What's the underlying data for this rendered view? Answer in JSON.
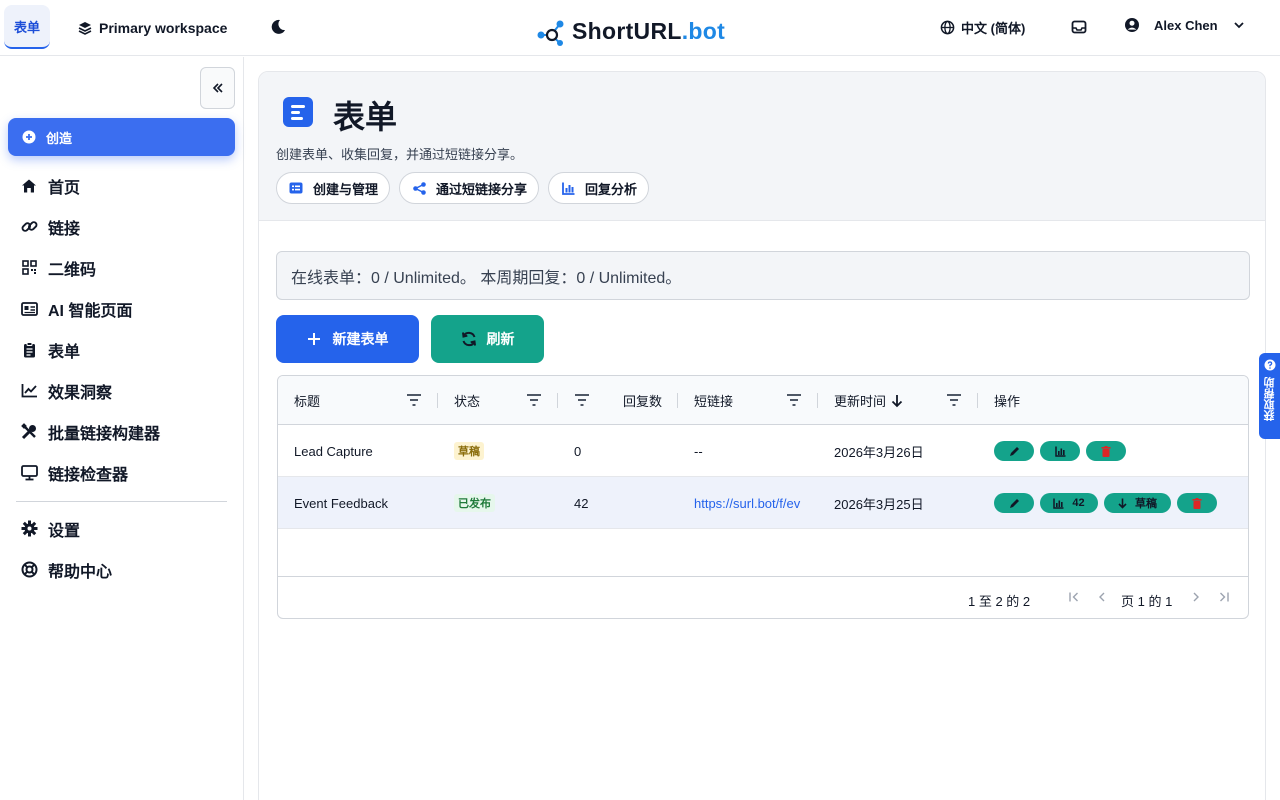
{
  "topbar": {
    "active_tab": "表单",
    "workspace": "Primary workspace",
    "brand_main": "ShortURL",
    "brand_dot": ".bot",
    "language": "中文 (简体)",
    "user_name": "Alex Chen"
  },
  "sidebar": {
    "create_label": "创造",
    "items": [
      {
        "label": "首页",
        "icon": "home-icon"
      },
      {
        "label": "链接",
        "icon": "link-icon"
      },
      {
        "label": "二维码",
        "icon": "qr-icon"
      },
      {
        "label": "AI 智能页面",
        "icon": "id-card-icon"
      },
      {
        "label": "表单",
        "icon": "clipboard-icon"
      },
      {
        "label": "效果洞察",
        "icon": "chart-line-icon"
      },
      {
        "label": "批量链接构建器",
        "icon": "tools-icon"
      },
      {
        "label": "链接检查器",
        "icon": "monitor-icon"
      }
    ],
    "bottom_items": [
      {
        "label": "设置",
        "icon": "gear-icon"
      },
      {
        "label": "帮助中心",
        "icon": "lifebuoy-icon"
      }
    ]
  },
  "page": {
    "title": "表单",
    "subtitle": "创建表单、收集回复，并通过短链接分享。",
    "pills": [
      "创建与管理",
      "通过短链接分享",
      "回复分析"
    ],
    "usage": "在线表单：0 / Unlimited。 本周期回复：0 / Unlimited。",
    "new_button": "新建表单",
    "refresh_button": "刷新"
  },
  "grid": {
    "columns": [
      "标题",
      "状态",
      "回复数",
      "短链接",
      "更新时间",
      "操作"
    ],
    "rows": [
      {
        "title": "Lead Capture",
        "status": "草稿",
        "responses": "0",
        "link": "--",
        "updated": "2026年3月26日"
      },
      {
        "title": "Event Feedback",
        "status": "已发布",
        "responses": "42",
        "link": "https://surl.bot/f/ev",
        "updated": "2026年3月25日",
        "analytics_count": "42",
        "draft_action": "草稿"
      }
    ],
    "pager": {
      "range": "1 至 2 的 2",
      "page": "页 1 的 1"
    }
  },
  "help_tab": "获取帮助",
  "colors": {
    "primary": "#2563eb",
    "teal": "#14a38b",
    "draft_bg": "#fdf3d0",
    "published_bg": "#e6f7ec"
  }
}
